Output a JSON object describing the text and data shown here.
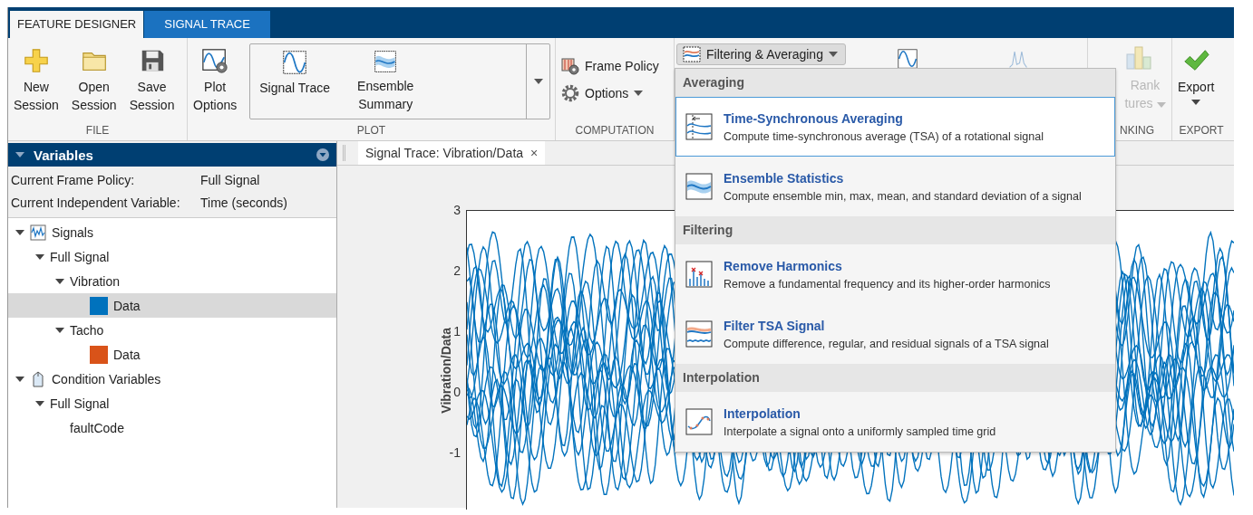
{
  "tabs": [
    {
      "label": "FEATURE DESIGNER",
      "selected": true
    },
    {
      "label": "SIGNAL TRACE",
      "selected": false
    }
  ],
  "ribbon": {
    "file": {
      "label": "FILE",
      "buttons": [
        [
          "New",
          "Session"
        ],
        [
          "Open",
          "Session"
        ],
        [
          "Save",
          "Session"
        ]
      ]
    },
    "plot": {
      "label": "PLOT",
      "options": [
        "Plot",
        "Options"
      ],
      "gallery": [
        [
          "Signal Trace"
        ],
        [
          "Ensemble",
          "Summary"
        ]
      ]
    },
    "computation": {
      "label": "COMPUTATION",
      "frame_policy": "Frame Policy",
      "options": "Options"
    },
    "filtering": {
      "button": "Filtering & Averaging",
      "expanded": true
    },
    "ranking": {
      "lines": [
        "Rank",
        "tures"
      ],
      "label": "NKING"
    },
    "export": {
      "button": "Export",
      "label": "EXPORT"
    }
  },
  "menu": {
    "groups": [
      {
        "heading": "Averaging",
        "items": [
          {
            "title": "Time-Synchronous Averaging",
            "description": "Compute time-synchronous average (TSA) of a rotational signal",
            "selected": true
          },
          {
            "title": "Ensemble Statistics",
            "description": "Compute ensemble min, max, mean, and standard deviation of a signal",
            "selected": false
          }
        ]
      },
      {
        "heading": "Filtering",
        "items": [
          {
            "title": "Remove Harmonics",
            "description": "Remove a fundamental frequency and its higher-order harmonics",
            "selected": false
          },
          {
            "title": "Filter TSA Signal",
            "description": "Compute difference, regular, and residual signals of a TSA signal",
            "selected": false
          }
        ]
      },
      {
        "heading": "Interpolation",
        "items": [
          {
            "title": "Interpolation",
            "description": "Interpolate a signal onto a uniformly sampled time grid",
            "selected": false
          }
        ]
      }
    ]
  },
  "variables_panel": {
    "title": "Variables",
    "info": [
      {
        "label": "Current Frame Policy:",
        "value": "Full Signal"
      },
      {
        "label": "Current Independent Variable:",
        "value": "Time (seconds)"
      }
    ],
    "tree": [
      {
        "label": "Signals",
        "kind": "signals",
        "expanded": true,
        "selected": false,
        "children": [
          {
            "label": "Full Signal",
            "expanded": true,
            "selected": false,
            "children": [
              {
                "label": "Vibration",
                "expanded": true,
                "selected": false,
                "children": [
                  {
                    "label": "Data",
                    "kind": "swatch",
                    "color": "#0072bd",
                    "selected": true
                  }
                ]
              },
              {
                "label": "Tacho",
                "expanded": true,
                "selected": false,
                "children": [
                  {
                    "label": "Data",
                    "kind": "swatch",
                    "color": "#d95319",
                    "selected": false
                  }
                ]
              }
            ]
          }
        ]
      },
      {
        "label": "Condition Variables",
        "kind": "condition",
        "expanded": true,
        "selected": false,
        "children": [
          {
            "label": "Full Signal",
            "expanded": true,
            "selected": false,
            "children": [
              {
                "label": "faultCode",
                "selected": false
              }
            ]
          }
        ]
      }
    ]
  },
  "document_tab": {
    "label": "Signal Trace: Vibration/Data",
    "close": "×"
  },
  "axes": {
    "ylabel": "Vibration/Data",
    "yticks": [
      "3",
      "2",
      "1",
      "0",
      "-1"
    ]
  }
}
